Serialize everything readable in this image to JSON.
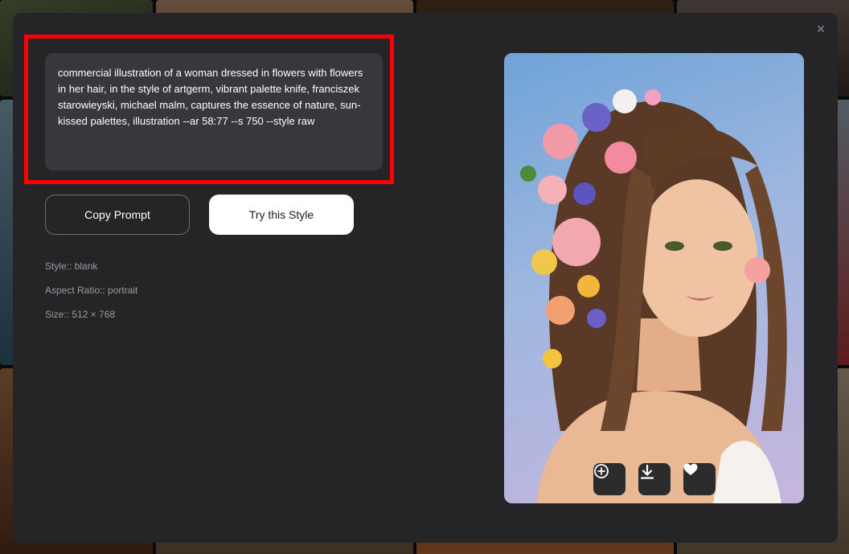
{
  "modal": {
    "close_symbol": "×",
    "prompt_text": "commercial illustration of a woman dressed in flowers with flowers in her hair, in the style of artgerm, vibrant palette knife, franciszek starowieyski, michael malm, captures the essence of nature, sun-kissed palettes, illustration --ar 58:77 --s 750 --style raw",
    "buttons": {
      "copy_prompt": "Copy Prompt",
      "try_style": "Try this Style"
    },
    "meta": {
      "style": "Style:: blank",
      "aspect_ratio": "Aspect Ratio:: portrait",
      "size": "Size:: 512 × 768"
    },
    "image_actions": {
      "upscale_icon": "zoom-plus-icon",
      "download_icon": "download-icon",
      "favorite_icon": "heart-icon"
    }
  },
  "colors": {
    "modal_bg": "#252528",
    "prompt_bg": "#37373c",
    "highlight": "#ff0000",
    "primary_button_bg": "#ffffff"
  }
}
